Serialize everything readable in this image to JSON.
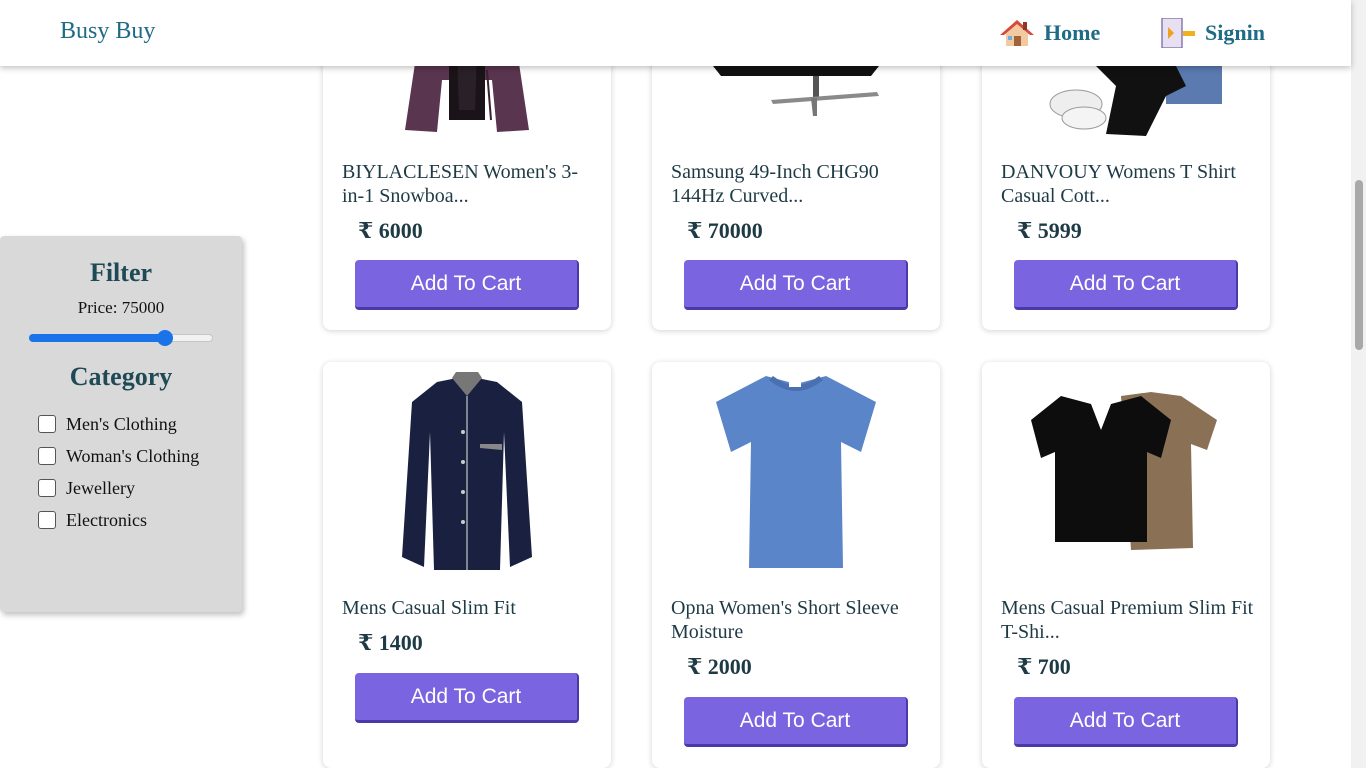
{
  "brand": "Busy Buy",
  "nav": {
    "home_label": "Home",
    "signin_label": "Signin"
  },
  "filter": {
    "title": "Filter",
    "price_label": "Price: 75000",
    "price_level_percent": 74,
    "category_title": "Category",
    "categories": [
      "Men's Clothing",
      "Woman's Clothing",
      "Jewellery",
      "Electronics"
    ]
  },
  "products": [
    {
      "title": "BIYLACLESEN Women's 3-in-1 Snowboa...",
      "price": "₹ 6000",
      "button": "Add To Cart",
      "image": "purple-jacket"
    },
    {
      "title": "Samsung 49-Inch CHG90 144Hz Curved...",
      "price": "₹ 70000",
      "button": "Add To Cart",
      "image": "curved-monitor"
    },
    {
      "title": "DANVOUY Womens T Shirt Casual Cott...",
      "price": "₹ 5999",
      "button": "Add To Cart",
      "image": "tshirt-outfit"
    },
    {
      "title": "Mens Casual Slim Fit",
      "price": "₹ 1400",
      "button": "Add To Cart",
      "image": "navy-shirt"
    },
    {
      "title": "Opna Women's Short Sleeve Moisture",
      "price": "₹ 2000",
      "button": "Add To Cart",
      "image": "blue-tshirt"
    },
    {
      "title": "Mens Casual Premium Slim Fit T-Shi...",
      "price": "₹ 700",
      "button": "Add To Cart",
      "image": "two-tshirts"
    }
  ]
}
